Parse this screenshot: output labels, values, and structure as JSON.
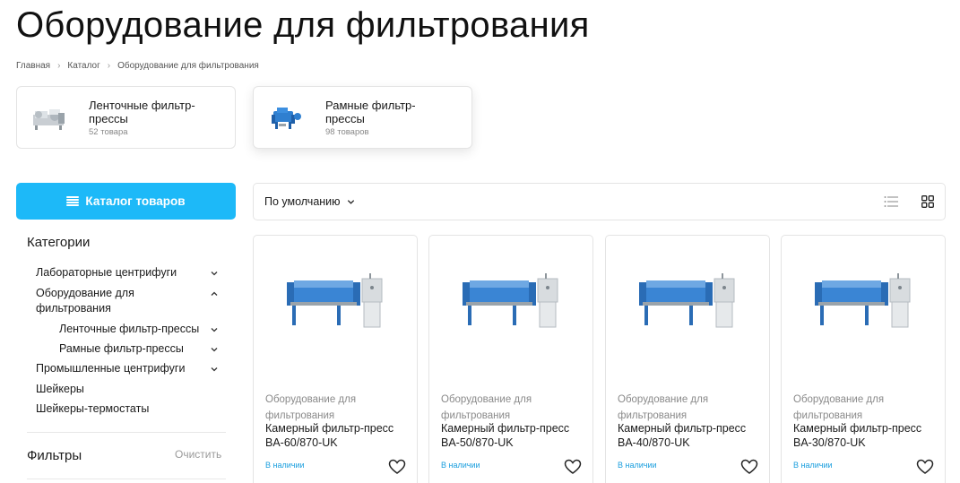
{
  "page": {
    "title": "Оборудование для фильтрования"
  },
  "breadcrumb": [
    "Главная",
    "Каталог",
    "Оборудование для фильтрования"
  ],
  "subcategories": [
    {
      "name": "Ленточные фильтр-прессы",
      "count": "52 товара"
    },
    {
      "name": "Рамные фильтр-прессы",
      "count": "98 товаров"
    }
  ],
  "catalog_button": {
    "label": "Каталог товаров"
  },
  "sidebar": {
    "categories_title": "Категории",
    "items": [
      {
        "label": "Лабораторные центрифуги"
      },
      {
        "label": "Оборудование для фильтрования"
      },
      {
        "label": "Ленточные фильтр-прессы"
      },
      {
        "label": "Рамные фильтр-прессы"
      },
      {
        "label": "Промышленные центрифуги"
      },
      {
        "label": "Шейкеры"
      },
      {
        "label": "Шейкеры-термостаты"
      }
    ],
    "filters_title": "Фильтры",
    "filters_clear": "Очистить"
  },
  "toolbar": {
    "sort_label": "По умолчанию",
    "active_view": "grid"
  },
  "products": [
    {
      "category": "Оборудование для фильтрования",
      "name": "Камерный фильтр-пресс BA-60/870-UK",
      "stock": "В наличии"
    },
    {
      "category": "Оборудование для фильтрования",
      "name": "Камерный фильтр-пресс BA-50/870-UK",
      "stock": "В наличии"
    },
    {
      "category": "Оборудование для фильтрования",
      "name": "Камерный фильтр-пресс BA-40/870-UK",
      "stock": "В наличии"
    },
    {
      "category": "Оборудование для фильтрования",
      "name": "Камерный фильтр-пресс BA-30/870-UK",
      "stock": "В наличии"
    }
  ],
  "colors": {
    "accent": "#1db9f8",
    "stock": "#1a9ede",
    "machine_blue": "#2f7fd0"
  },
  "icons": [
    "menu-icon",
    "chevron-right-icon",
    "chevron-down-icon",
    "chevron-up-icon",
    "list-view-icon",
    "grid-view-icon",
    "heart-icon"
  ]
}
